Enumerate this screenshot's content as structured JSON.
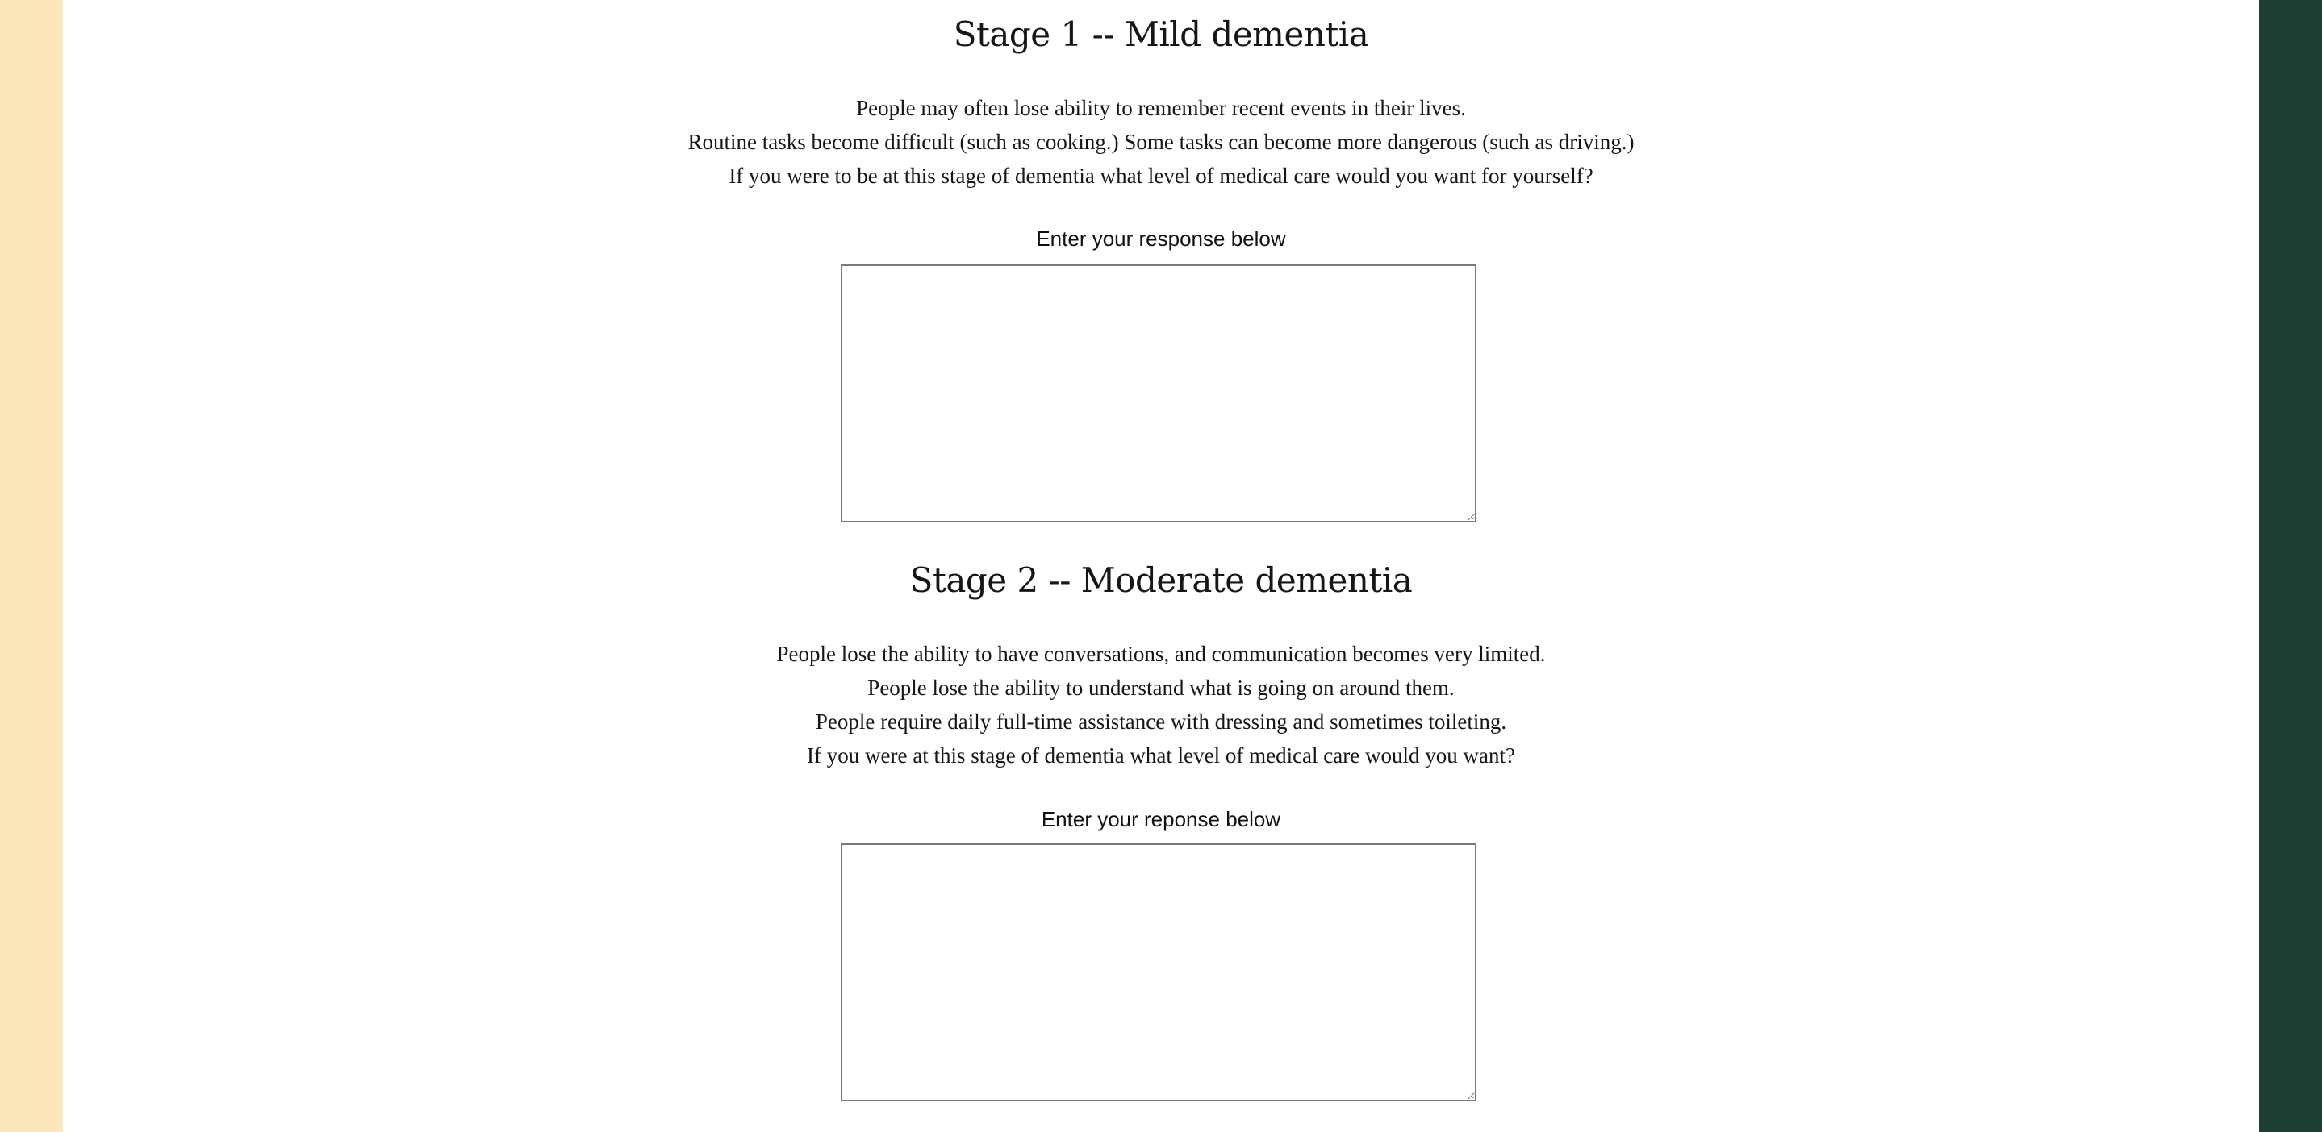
{
  "colors": {
    "left_stripe": "#fbe6bb",
    "right_stripe": "#1e3d33",
    "background": "#ffffff"
  },
  "stages": [
    {
      "title": "Stage 1 -- Mild dementia",
      "description": [
        "People may often lose ability to remember recent events in their lives.",
        "Routine tasks become difficult (such as cooking.) Some tasks can become more dangerous (such as driving.)",
        "If you were to be at this stage of dementia what level of medical care would you want for yourself?"
      ],
      "prompt_label": "Enter your response below",
      "response_value": ""
    },
    {
      "title": "Stage 2 -- Moderate dementia",
      "description": [
        "People lose the ability to have conversations, and communication becomes very limited.",
        "People lose the ability to understand what is going on around them.",
        "People require daily full-time assistance with dressing and sometimes toileting.",
        "If you were at this stage of dementia what level of medical care would you want?"
      ],
      "prompt_label": "Enter your reponse below",
      "response_value": ""
    }
  ]
}
